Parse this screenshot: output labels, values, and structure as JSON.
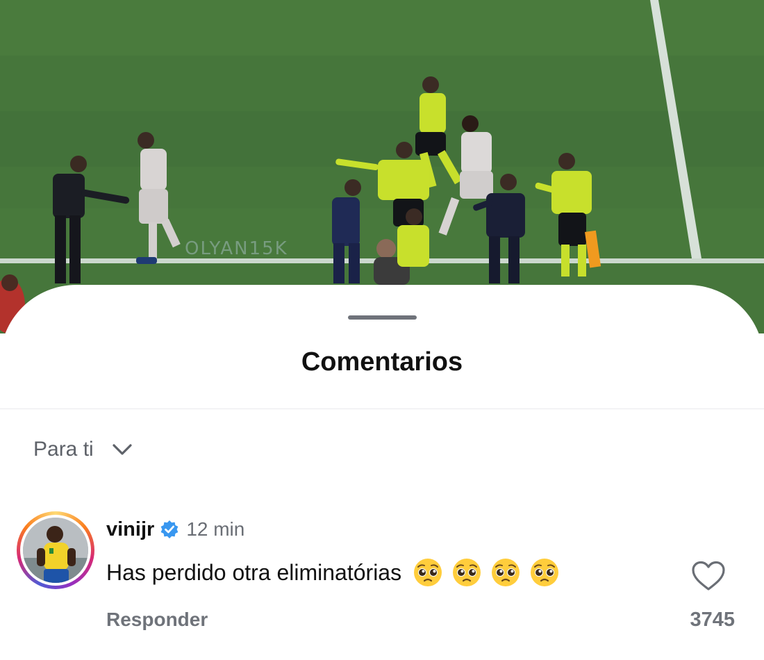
{
  "video": {
    "watermark": "OLYAN15K"
  },
  "sheet": {
    "title": "Comentarios"
  },
  "sort": {
    "label": "Para ti",
    "icon": "chevron-down-icon"
  },
  "comment": {
    "username": "vinijr",
    "verified": true,
    "timestamp": "12 min",
    "text": "Has perdido otra eliminatórias",
    "emojis": [
      "pleading-face",
      "pleading-face",
      "pleading-face",
      "pleading-face"
    ],
    "reply_label": "Responder",
    "like_count": "3745",
    "like_icon": "heart-outline-icon"
  },
  "colors": {
    "verified_blue": "#3897f0",
    "secondary_text": "#6f737a",
    "primary_text": "#111111"
  }
}
